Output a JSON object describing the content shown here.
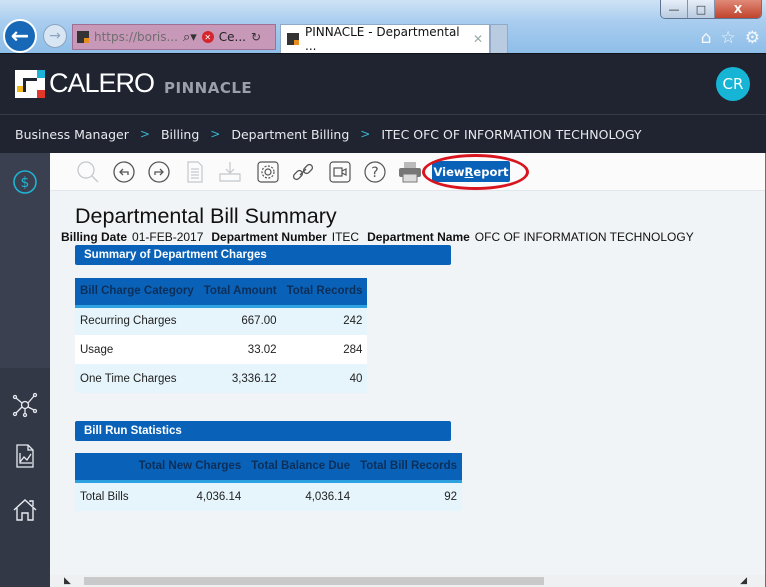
{
  "browser": {
    "address_url": "https://boris...",
    "cert_label": "Ce...",
    "tab_title": "PINNACLE - Departmental ...",
    "window_buttons": {
      "minimize": "—",
      "maximize": "□",
      "close": "X"
    }
  },
  "app": {
    "brand": "CALERO",
    "product": "PINNACLE",
    "user_initials": "CR",
    "accent_color": "#0a62b8"
  },
  "breadcrumb": [
    "Business Manager",
    "Billing",
    "Department Billing",
    "ITEC OFC OF INFORMATION TECHNOLOGY"
  ],
  "toolbar": {
    "icons": [
      "search-icon",
      "undo-icon",
      "redo-icon",
      "document-icon",
      "download-icon",
      "settings-icon",
      "link-icon",
      "video-icon",
      "help-icon",
      "print-icon"
    ],
    "view_report_pre": "View ",
    "view_report_ul": "R",
    "view_report_post": "eport"
  },
  "sidebar": {
    "items": [
      "billing-dollar",
      "network",
      "reports",
      "home"
    ]
  },
  "report": {
    "title": "Departmental Bill Summary",
    "billing_date_label": "Billing Date",
    "billing_date": "01-FEB-2017",
    "dept_number_label": "Department Number",
    "dept_number": "ITEC",
    "dept_name_label": "Department Name",
    "dept_name": "OFC OF INFORMATION TECHNOLOGY",
    "charges": {
      "section_title": "Summary of Department Charges",
      "headers": [
        "Bill Charge Category",
        "Total Amount",
        "Total Records"
      ],
      "rows": [
        [
          "Recurring Charges",
          "667.00",
          "242"
        ],
        [
          "Usage",
          "33.02",
          "284"
        ],
        [
          "One Time Charges",
          "3,336.12",
          "40"
        ]
      ]
    },
    "stats": {
      "section_title": "Bill Run Statistics",
      "headers": [
        "",
        "Total New Charges",
        "Total Balance Due",
        "Total Bill Records"
      ],
      "rows": [
        [
          "Total Bills",
          "4,036.14",
          "4,036.14",
          "92"
        ]
      ]
    }
  }
}
